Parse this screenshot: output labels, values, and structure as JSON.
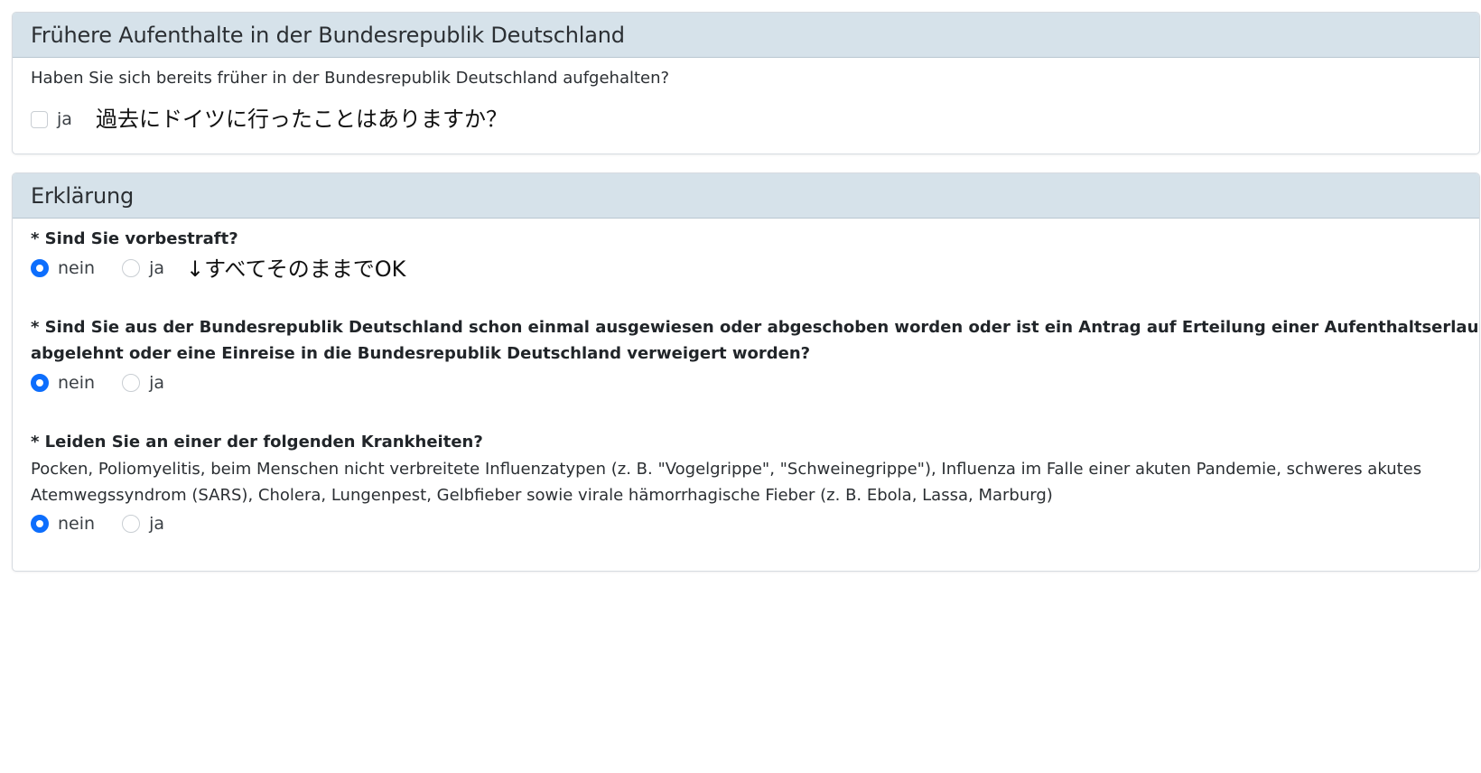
{
  "prior_stays": {
    "header": "Frühere Aufenthalte in der Bundesrepublik Deutschland",
    "question": "Haben Sie sich bereits früher in der Bundesrepublik Deutschland aufgehalten?",
    "option_label": "ja",
    "checked": false,
    "annotation": "過去にドイツに行ったことはありますか？"
  },
  "declaration": {
    "header": "Erklärung",
    "annotation": "↓すべてそのままでOK",
    "q1": {
      "label": "* Sind Sie vorbestraft?",
      "option_nein": "nein",
      "option_ja": "ja",
      "selected": "nein"
    },
    "q2": {
      "label_line1": "* Sind Sie aus der Bundesrepublik Deutschland schon einmal ausgewiesen oder abgeschoben worden oder ist ein Antrag auf Erteilung einer Aufenthaltserlaubnis",
      "label_line2": "abgelehnt oder eine Einreise in die Bundesrepublik Deutschland verweigert worden?",
      "option_nein": "nein",
      "option_ja": "ja",
      "selected": "nein"
    },
    "q3": {
      "label": "* Leiden Sie an einer der folgenden Krankheiten?",
      "desc_line1": "Pocken, Poliomyelitis, beim Menschen nicht verbreitete Influenzatypen (z. B. \"Vogelgrippe\", \"Schweinegrippe\"), Influenza im Falle einer akuten Pandemie, schweres akutes",
      "desc_line2": "Atemwegssyndrom (SARS), Cholera, Lungenpest, Gelbfieber sowie virale hämorrhagische Fieber (z. B. Ebola, Lassa, Marburg)",
      "option_nein": "nein",
      "option_ja": "ja",
      "selected": "nein"
    }
  },
  "colors": {
    "header_bg": "#d6e2ea",
    "radio_checked": "#0d6efd",
    "border": "#d6dbe0"
  }
}
